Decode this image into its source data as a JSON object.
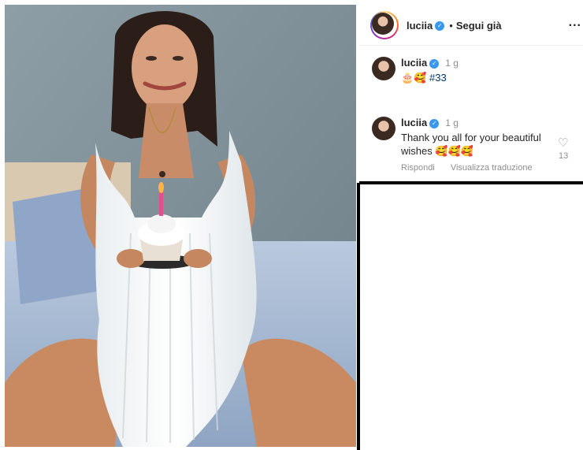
{
  "post": {
    "username": "luciia",
    "separator": "•",
    "follow_label": "Segui già",
    "more_label": "..."
  },
  "comments": [
    {
      "username": "luciia",
      "time": "1 g",
      "emojis": "🎂🥰",
      "hashtag": "#33"
    },
    {
      "username": "luciia",
      "time": "1 g",
      "text": "Thank you all for your beautiful wishes",
      "emojis": "🥰🥰🥰",
      "like_count": "13",
      "reply_label": "Rispondi",
      "translate_label": "Visualizza traduzione"
    }
  ],
  "colors": {
    "verified": "#3897f0",
    "hashtag": "#00376b",
    "secondary_text": "#8e8e8e"
  },
  "icons": [
    "verified-badge-icon",
    "heart-icon",
    "more-options-icon"
  ]
}
